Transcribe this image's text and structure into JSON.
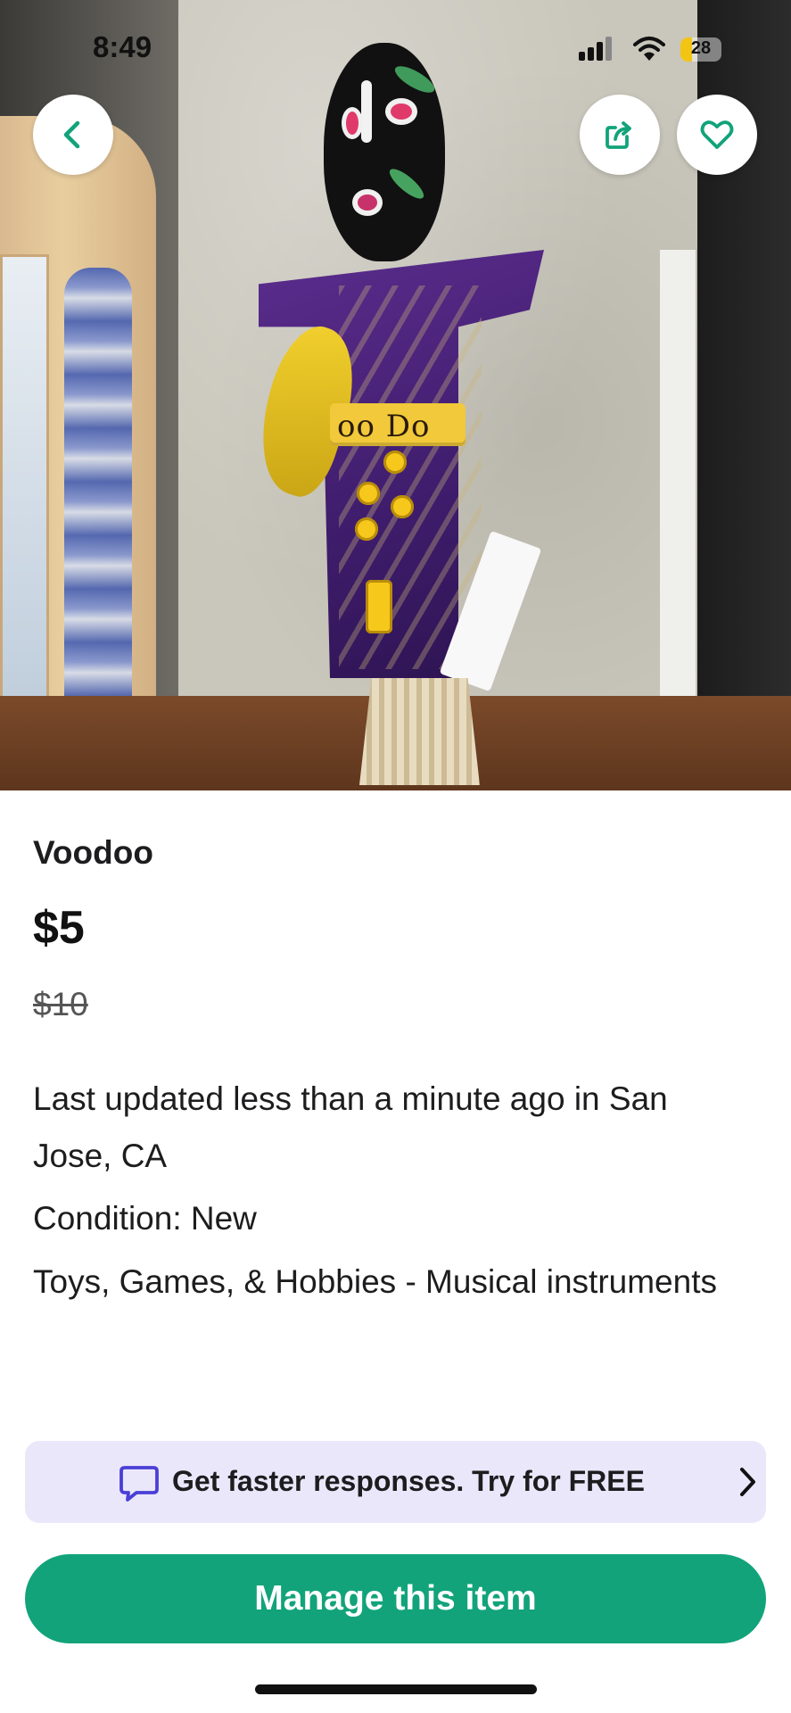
{
  "status_bar": {
    "time": "8:49",
    "battery_level": "28",
    "battery_fraction": 0.28,
    "icons": [
      "cellular-signal-icon",
      "wifi-icon",
      "battery-icon"
    ]
  },
  "photo": {
    "band_text": "oo Do"
  },
  "photo_actions": {
    "back_icon": "chevron-left-icon",
    "share_icon": "share-icon",
    "favorite_icon": "heart-icon"
  },
  "listing": {
    "title": "Voodoo",
    "price": "$5",
    "original_price": "$10",
    "last_updated": "Last updated less than a minute ago in San Jose, CA",
    "condition": "Condition: New",
    "category": "Toys, Games, & Hobbies - Musical instruments"
  },
  "promo": {
    "icon": "chat-bubble-icon",
    "text": "Get faster responses. Try for FREE",
    "chevron_icon": "chevron-right-icon"
  },
  "actions": {
    "manage_label": "Manage this item"
  },
  "colors": {
    "accent": "#12a37a",
    "promo_background": "#ebe7fb",
    "promo_icon": "#4a3fd6",
    "battery": "#f2c515"
  }
}
